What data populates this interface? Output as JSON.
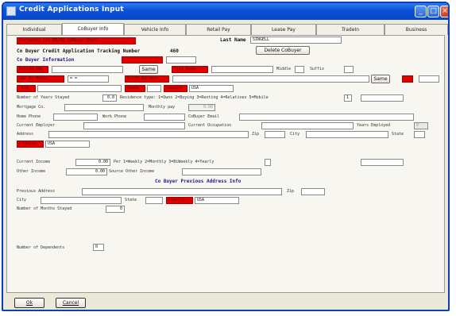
{
  "window": {
    "title": "Credit Applications Input"
  },
  "tabs": [
    "Individual",
    "CoBuyer Info",
    "Vehicle Info",
    "Retail Pay",
    "Lease Pay",
    "TradeIn",
    "Business"
  ],
  "banner": {
    "red_text": "Perimeter ist BM/P@ rpBeagr fHatc.",
    "last_name_label": "Last Name",
    "last_name_value": "SINGELL",
    "delete_button": "Delete CoBuyer"
  },
  "tracking": {
    "label": "Co Buyer Credit Application Tracking Number",
    "value": "460"
  },
  "section": {
    "title": "Co Buyer Information"
  },
  "row_name": {
    "red1": "Relitd kNs",
    "red2": "Frst Name",
    "same": "Same",
    "middle": "Middle",
    "suffix": "Suffix"
  },
  "row_ssn": {
    "red1": "Sec Se Hhebr",
    "dob": "=  =",
    "red2": "Birth Address",
    "same": "Same"
  },
  "row_city": {
    "red1": "City",
    "red2": "State",
    "red3": "Country",
    "country": "USA"
  },
  "years_stayed": {
    "label": "Number of Years Stayed",
    "value": "0.0",
    "residence_label": "Residence type: 1=Owns 2=Buying 3=Renting 4=Relatives 5=Mobile",
    "residence_value": "1"
  },
  "mortgage": {
    "label": "Mortgage Co.",
    "monthly_label": "Monthly pay",
    "monthly_value": "0.00"
  },
  "phones": {
    "home": "Home Phone",
    "work": "Work Phone",
    "email": "CoBuyer Email"
  },
  "employment": {
    "employer": "Current Employer",
    "occupation": "Current Occupation",
    "years_label": "Years Employed",
    "years_value": "0"
  },
  "address": {
    "label": "Address",
    "zip": "Zip",
    "city": "City",
    "state": "State"
  },
  "country2": {
    "red": "Country",
    "value": "USA"
  },
  "income": {
    "label": "Current Income",
    "value": "0.00",
    "per_label": "Per 1=Weekly 2=Monthly 3=BiWeekly 4=Yearly",
    "other_label": "Other Income",
    "other_value": "0.00",
    "source_label": "Source Other Income"
  },
  "prev_section": {
    "title": "Co Buyer Previous Address Info"
  },
  "prev": {
    "address": "Previous Address",
    "zip": "Zip",
    "city": "City",
    "state": "State",
    "country_red": "Country",
    "country": "USA",
    "months_label": "Number of Months Stayed",
    "months_value": "0"
  },
  "dependents": {
    "label": "Number of Dependents",
    "value": "0"
  },
  "buttons": {
    "ok": "Ok",
    "cancel": "Cancel"
  }
}
